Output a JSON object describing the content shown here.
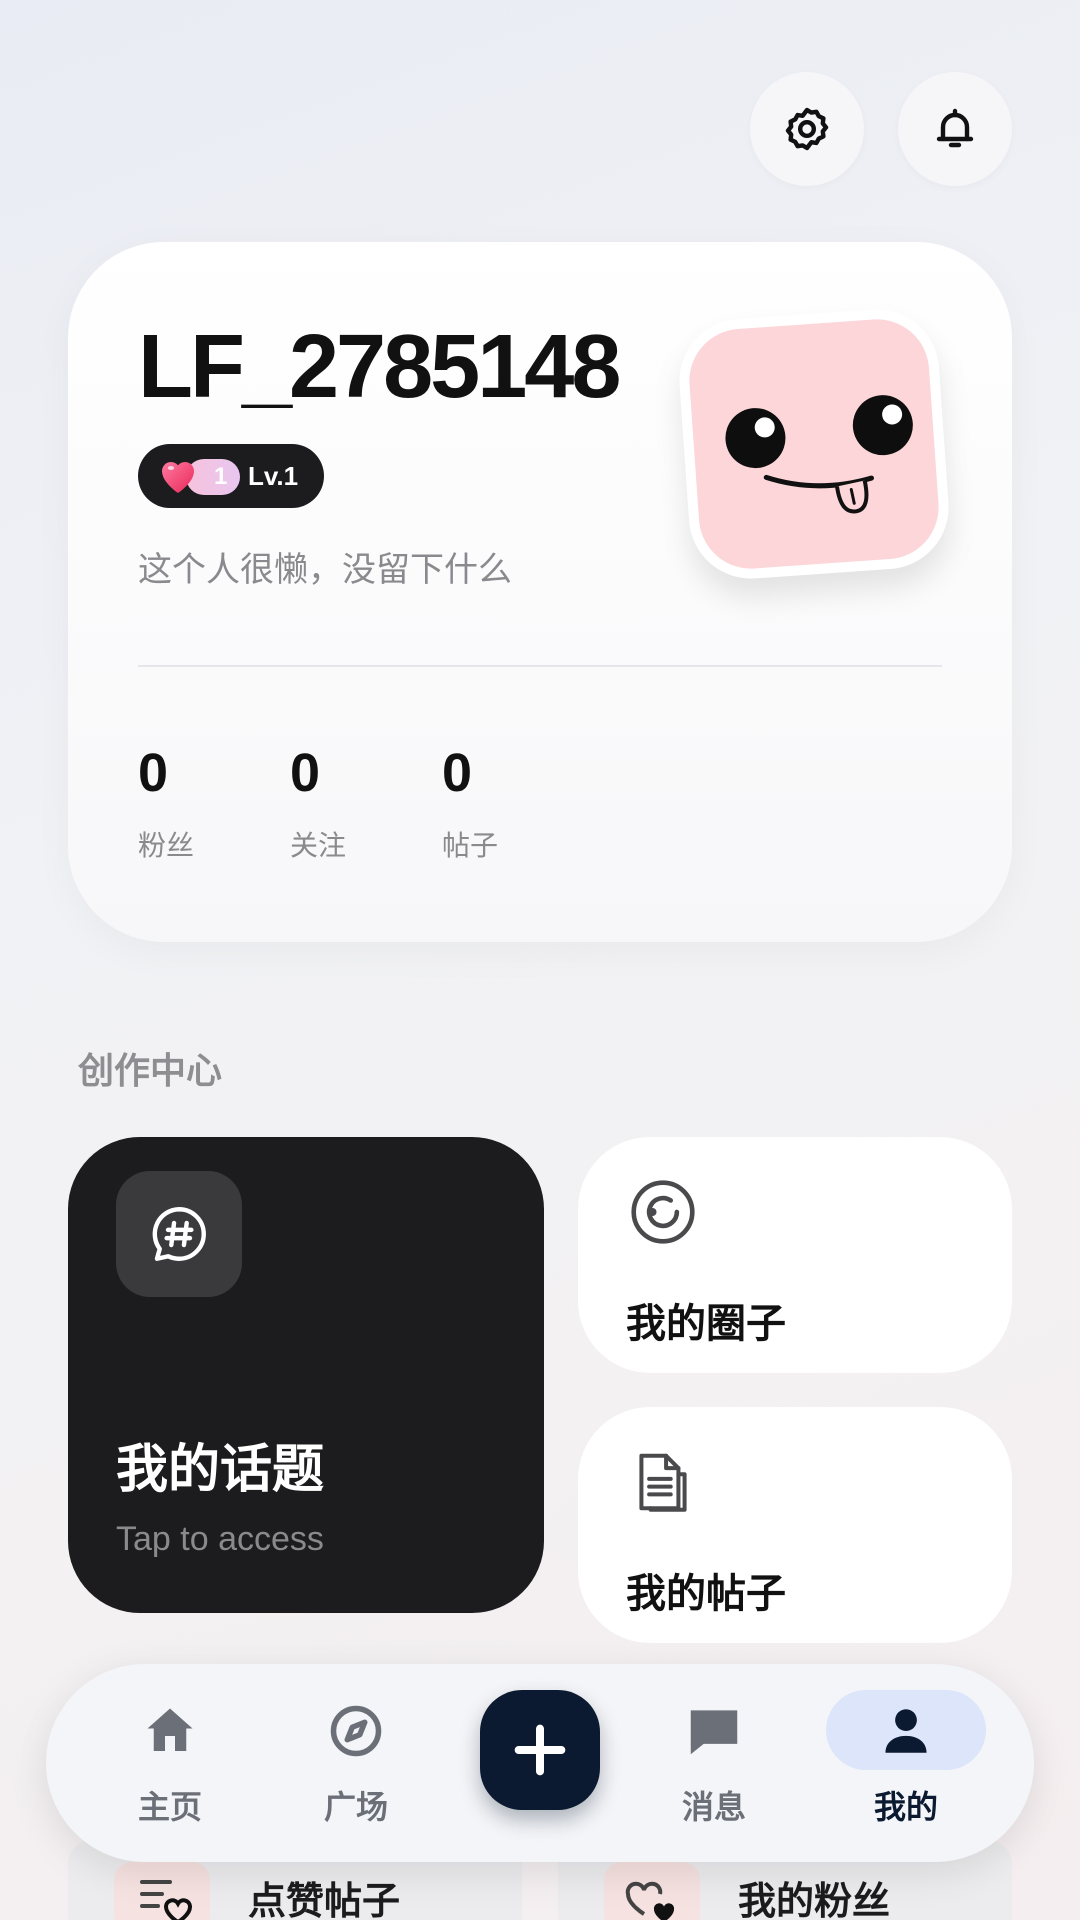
{
  "header": {
    "settings_icon": "gear-icon",
    "notifications_icon": "bell-icon"
  },
  "profile": {
    "username": "LF_2785148",
    "level_badge": {
      "heart_count": "1",
      "level": "Lv.1"
    },
    "bio": "这个人很懒，没留下什么",
    "avatar": "smiling-face-sticker",
    "stats": [
      {
        "value": "0",
        "label": "粉丝"
      },
      {
        "value": "0",
        "label": "关注"
      },
      {
        "value": "0",
        "label": "帖子"
      }
    ]
  },
  "creation_center": {
    "title": "创作中心",
    "topics": {
      "title": "我的话题",
      "subtitle": "Tap to access",
      "icon": "hashtag-chat-icon"
    },
    "circles": {
      "title": "我的圈子",
      "icon": "circle-icon"
    },
    "posts": {
      "title": "我的帖子",
      "icon": "document-icon"
    }
  },
  "more": {
    "liked_posts": "点赞帖子",
    "my_fans": "我的粉丝"
  },
  "tabbar": {
    "home": "主页",
    "square": "广场",
    "create_icon": "plus-icon",
    "messages": "消息",
    "mine": "我的",
    "active": "我的"
  },
  "colors": {
    "accent_dark": "#0b1a30",
    "active_tab_bg": "#dde5fb",
    "dark_card": "#1c1c1e",
    "avatar_pink": "#fcd6d8"
  }
}
